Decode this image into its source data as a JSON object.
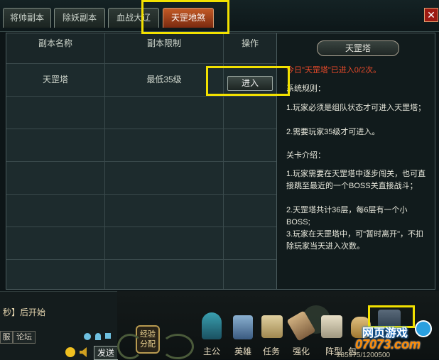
{
  "tabs": [
    {
      "label": "将帅副本"
    },
    {
      "label": "除妖副本"
    },
    {
      "label": "血战大辽"
    },
    {
      "label": "天罡地煞"
    }
  ],
  "close_label": "✕",
  "table": {
    "headers": [
      "副本名称",
      "副本限制",
      "操作"
    ],
    "rows": [
      {
        "name": "天罡塔",
        "limit": "最低35级",
        "action": "进入"
      }
    ]
  },
  "info": {
    "title": "天罡塔",
    "today": "今日\"天罡塔\"已进入0/2次。",
    "rules_heading": "系统规则：",
    "rules": [
      "1.玩家必须是组队状态才可进入天罡塔；",
      "2.需要玩家35级才可进入。"
    ],
    "intro_heading": "关卡介绍：",
    "intro": [
      "1.玩家需要在天罡塔中逐步闯关，也可直接跳至最近的一个BOSS关直接战斗；",
      "2.天罡塔共计36层，每6层有一个小BOSS;",
      "3.玩家在天罡塔中，可\"暂时离开\"，不扣除玩家当天进入次数。"
    ]
  },
  "chat": {
    "notice": "秒】后开始",
    "tabs": [
      "服",
      "论坛"
    ],
    "send": "发送"
  },
  "bottom_menu": [
    {
      "label": "主公",
      "icon": "character-icon"
    },
    {
      "label": "英雄",
      "icon": "hero-icon"
    },
    {
      "label": "任务",
      "icon": "scroll-icon"
    },
    {
      "label": "强化",
      "icon": "hammer-icon"
    },
    {
      "label": "阵型",
      "icon": "formation-icon"
    },
    {
      "label": "包",
      "icon": "bag-icon"
    }
  ],
  "exp_button": {
    "line1": "经验",
    "line2": "分配"
  },
  "status_number": "285975/1200500",
  "watermark": {
    "line1": "网页游戏",
    "line2": "07073.com"
  }
}
